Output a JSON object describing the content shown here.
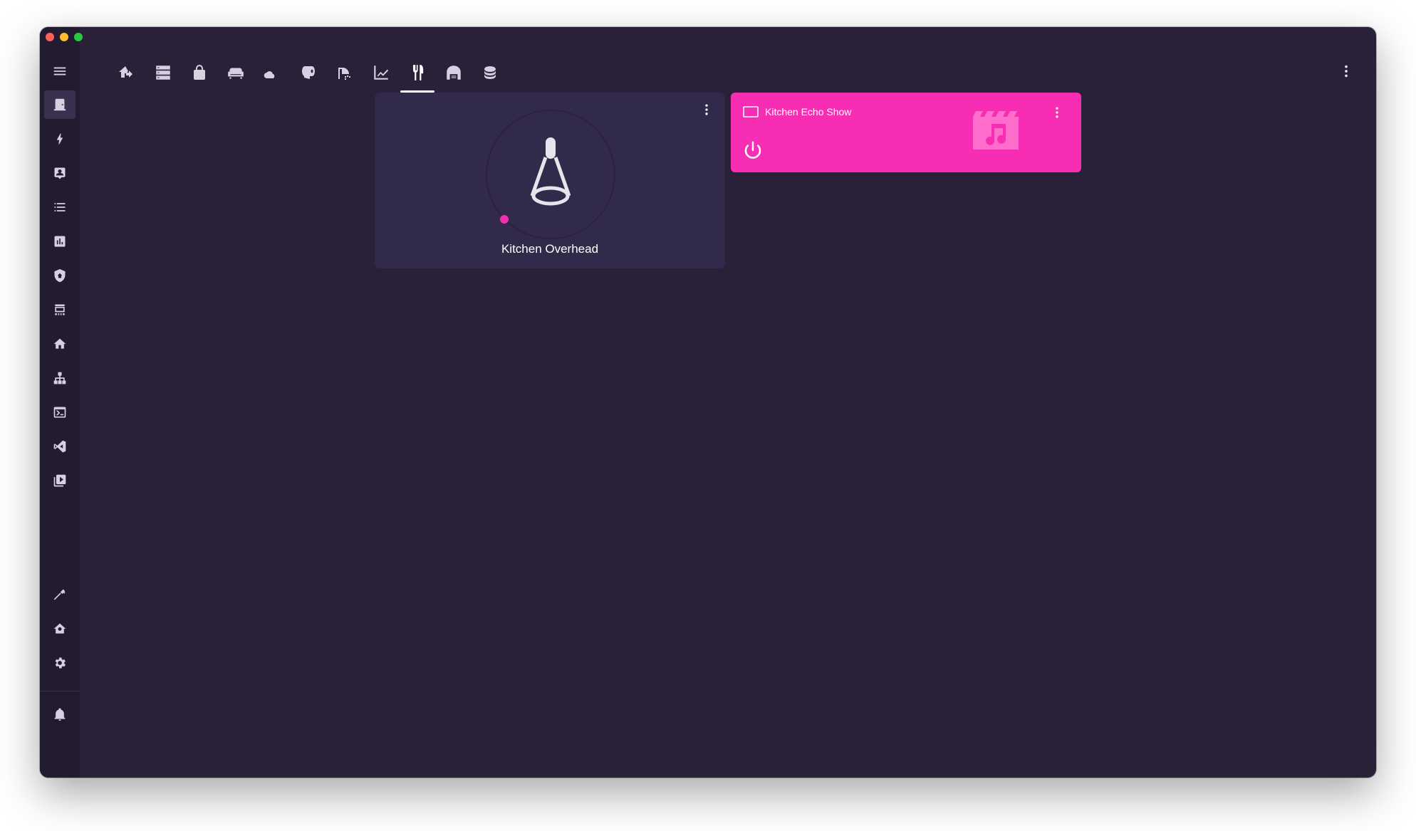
{
  "window": {
    "traffic_lights": [
      "close",
      "minimize",
      "maximize"
    ]
  },
  "sidebar": {
    "menu_icon": "menu-icon",
    "items": [
      {
        "name": "overview",
        "icon": "door-icon",
        "active": true
      },
      {
        "name": "energy",
        "icon": "lightning-icon"
      },
      {
        "name": "logbook",
        "icon": "account-box-icon"
      },
      {
        "name": "todo",
        "icon": "list-icon"
      },
      {
        "name": "history",
        "icon": "chart-box-icon"
      },
      {
        "name": "security",
        "icon": "shield-home-icon"
      },
      {
        "name": "hacs",
        "icon": "store-icon"
      },
      {
        "name": "home",
        "icon": "home-icon"
      },
      {
        "name": "network",
        "icon": "sitemap-icon"
      },
      {
        "name": "terminal",
        "icon": "console-icon"
      },
      {
        "name": "vscode",
        "icon": "code-icon"
      },
      {
        "name": "media",
        "icon": "play-box-icon"
      }
    ],
    "bottom_items": [
      {
        "name": "developer-tools",
        "icon": "hammer-icon"
      },
      {
        "name": "home-settings",
        "icon": "home-gear-icon"
      },
      {
        "name": "settings",
        "icon": "gear-icon"
      }
    ],
    "notifications_icon": "bell-icon"
  },
  "topbar": {
    "tabs": [
      {
        "name": "home-import",
        "icon": "home-import-icon"
      },
      {
        "name": "server",
        "icon": "server-icon"
      },
      {
        "name": "lock",
        "icon": "lock-icon"
      },
      {
        "name": "sofa",
        "icon": "sofa-icon"
      },
      {
        "name": "weather-night",
        "icon": "weather-icon"
      },
      {
        "name": "toilet-paper",
        "icon": "paper-roll-icon"
      },
      {
        "name": "shower",
        "icon": "shower-icon"
      },
      {
        "name": "chart",
        "icon": "chart-line-icon"
      },
      {
        "name": "kitchen",
        "icon": "silverware-icon",
        "active": true
      },
      {
        "name": "garage",
        "icon": "garage-icon"
      },
      {
        "name": "database",
        "icon": "database-icon"
      }
    ],
    "overflow_icon": "dots-vertical-icon"
  },
  "cards": {
    "light": {
      "name": "Kitchen Overhead",
      "brightness_fraction": 0.0,
      "state": "off"
    },
    "media": {
      "name": "Kitchen Echo Show",
      "accent": "#f72db3"
    }
  },
  "colors": {
    "background": "#2a2139",
    "sidebar": "#231c31",
    "card": "#322a4a",
    "accent": "#f72db3"
  }
}
